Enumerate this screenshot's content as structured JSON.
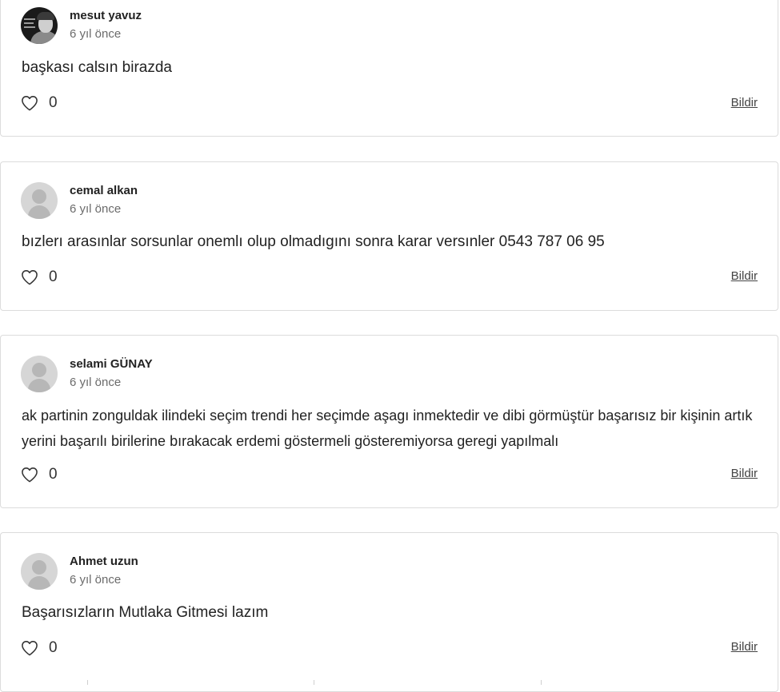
{
  "comments": [
    {
      "author": "mesut yavuz",
      "time": "6 yıl önce",
      "text": "başkası calsın birazda",
      "likes": "0",
      "report": "Bildir",
      "avatar": "photo"
    },
    {
      "author": "cemal alkan",
      "time": "6 yıl önce",
      "text": "bızlerı arasınlar sorsunlar onemlı olup olmadıgını sonra karar versınler 0543 787 06 95",
      "likes": "0",
      "report": "Bildir",
      "avatar": "default"
    },
    {
      "author": "selami GÜNAY",
      "time": "6 yıl önce",
      "text": "ak partinin zonguldak ilindeki seçim trendi her seçimde aşagı inmektedir ve dibi görmüştür başarısız bir kişinin artık yerini başarılı birilerine bırakacak erdemi göstermeli gösteremiyorsa geregi yapılmalı",
      "likes": "0",
      "report": "Bildir",
      "avatar": "default"
    },
    {
      "author": "Ahmet uzun",
      "time": "6 yıl önce",
      "text": "Başarısızların Mutlaka Gitmesi lazım",
      "likes": "0",
      "report": "Bildir",
      "avatar": "default"
    }
  ],
  "icons": {
    "like": "heart-outline-icon",
    "avatar_placeholder": "user-silhouette-icon"
  },
  "colors": {
    "border": "#dcdcdc",
    "text": "#222222",
    "muted": "#6b6b6b",
    "avatar_bg": "#d6d6d6"
  }
}
